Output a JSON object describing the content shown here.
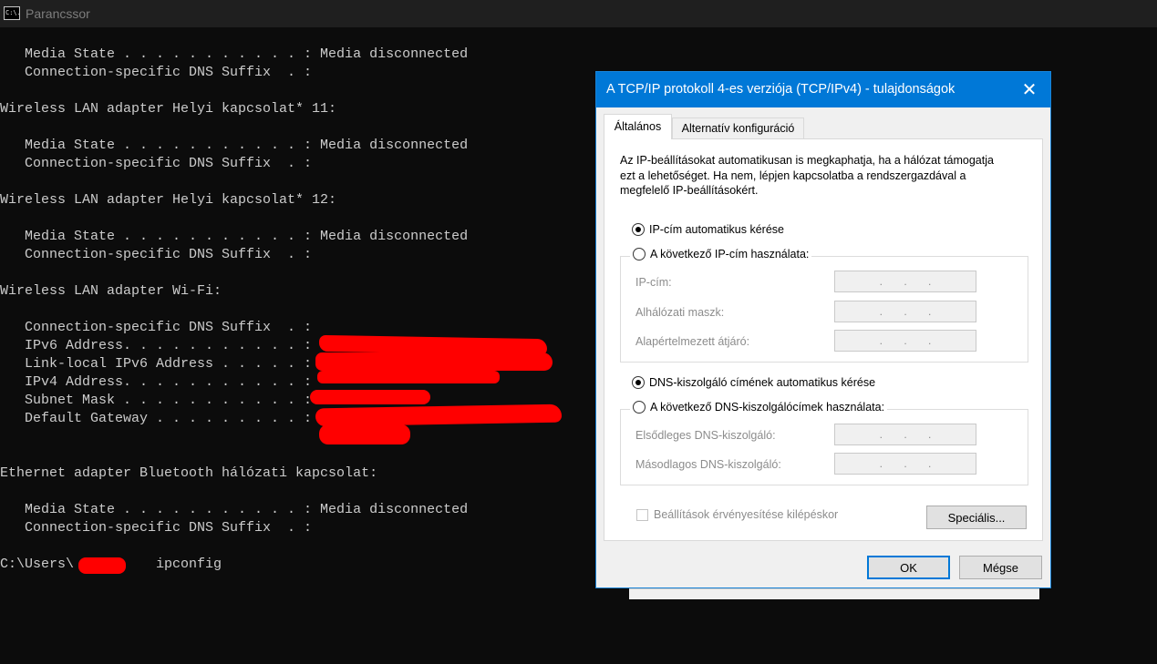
{
  "console_window": {
    "title": "Parancssor",
    "icon_text": "C:\\.",
    "lines": [
      "   Media State . . . . . . . . . . . : Media disconnected",
      "   Connection-specific DNS Suffix  . :",
      "",
      "Wireless LAN adapter Helyi kapcsolat* 11:",
      "",
      "   Media State . . . . . . . . . . . : Media disconnected",
      "   Connection-specific DNS Suffix  . :",
      "",
      "Wireless LAN adapter Helyi kapcsolat* 12:",
      "",
      "   Media State . . . . . . . . . . . : Media disconnected",
      "   Connection-specific DNS Suffix  . :",
      "",
      "Wireless LAN adapter Wi-Fi:",
      "",
      "   Connection-specific DNS Suffix  . :",
      "   IPv6 Address. . . . . . . . . . . :",
      "   Link-local IPv6 Address . . . . . :",
      "   IPv4 Address. . . . . . . . . . . :",
      "   Subnet Mask . . . . . . . . . . . :",
      "   Default Gateway . . . . . . . . . :",
      "",
      "",
      "Ethernet adapter Bluetooth hálózati kapcsolat:",
      "",
      "   Media State . . . . . . . . . . . : Media disconnected",
      "   Connection-specific DNS Suffix  . :",
      "",
      "C:\\Users\\          ipconfig"
    ]
  },
  "dialog": {
    "title": "A TCP/IP protokoll 4-es verziója (TCP/IPv4) - tulajdonságok",
    "close_glyph": "✕",
    "tabs": [
      {
        "label": "Általános",
        "active": true
      },
      {
        "label": "Alternatív konfiguráció",
        "active": false
      }
    ],
    "description": "Az IP-beállításokat automatikusan is megkaphatja, ha a hálózat támogatja ezt a lehetőséget. Ha nem, lépjen kapcsolatba a rendszergazdával a megfelelő IP-beállításokért.",
    "ip_section": {
      "auto_label": "IP-cím automatikus kérése",
      "manual_label": "A következő IP-cím használata:",
      "selected": "auto",
      "fields": [
        {
          "label": "IP-cím:",
          "value": ".       .       ."
        },
        {
          "label": "Alhálózati maszk:",
          "value": ".       .       ."
        },
        {
          "label": "Alapértelmezett átjáró:",
          "value": ".       .       ."
        }
      ]
    },
    "dns_section": {
      "auto_label": "DNS-kiszolgáló címének automatikus kérése",
      "manual_label": "A következő DNS-kiszolgálócímek használata:",
      "selected": "auto",
      "fields": [
        {
          "label": "Elsődleges DNS-kiszolgáló:",
          "value": ".       .       ."
        },
        {
          "label": "Másodlagos DNS-kiszolgáló:",
          "value": ".       .       ."
        }
      ]
    },
    "validate_on_exit_label": "Beállítások érvényesítése kilépéskor",
    "validate_on_exit_checked": false,
    "advanced_button": "Speciális...",
    "ok_button": "OK",
    "cancel_button": "Mégse"
  },
  "colors": {
    "console_bg": "#0c0c0c",
    "console_text": "#cccccc",
    "dialog_title_bg": "#0078d7",
    "redaction": "#ff0000"
  }
}
